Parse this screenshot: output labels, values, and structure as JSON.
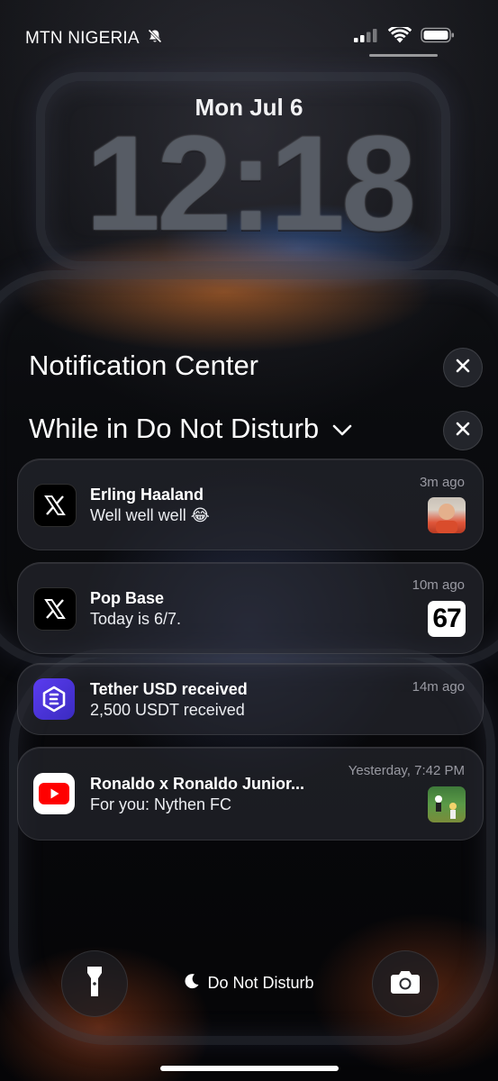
{
  "status_bar": {
    "carrier": "MTN NIGERIA",
    "icons": [
      "bell-slash-icon",
      "signal-icon",
      "wifi-icon",
      "battery-icon"
    ]
  },
  "lock": {
    "date": "Mon Jul 6",
    "time": "12:18"
  },
  "notification_center": {
    "title": "Notification Center",
    "dnd_group_title": "While in Do Not Disturb"
  },
  "notifications": [
    {
      "app_icon": "x-icon",
      "title": "Erling Haaland",
      "body": "Well well well 😂",
      "time": "3m ago",
      "thumb": "photo"
    },
    {
      "app_icon": "x-icon",
      "title": "Pop Base",
      "body": "Today is 6/7.",
      "time": "10m ago",
      "thumb_text": "67"
    },
    {
      "app_icon": "tether-icon",
      "title": "Tether USD received",
      "body": "2,500 USDT received",
      "time": "14m ago"
    },
    {
      "app_icon": "youtube-icon",
      "title": "Ronaldo x Ronaldo Junior...",
      "body": "For you: Nythen FC",
      "time": "Yesterday, 7:42 PM",
      "thumb": "video"
    }
  ],
  "bottom": {
    "focus_label": "Do Not Disturb"
  },
  "colors": {
    "tether_accent": "#5b3cf0",
    "youtube_red": "#ff0000"
  }
}
